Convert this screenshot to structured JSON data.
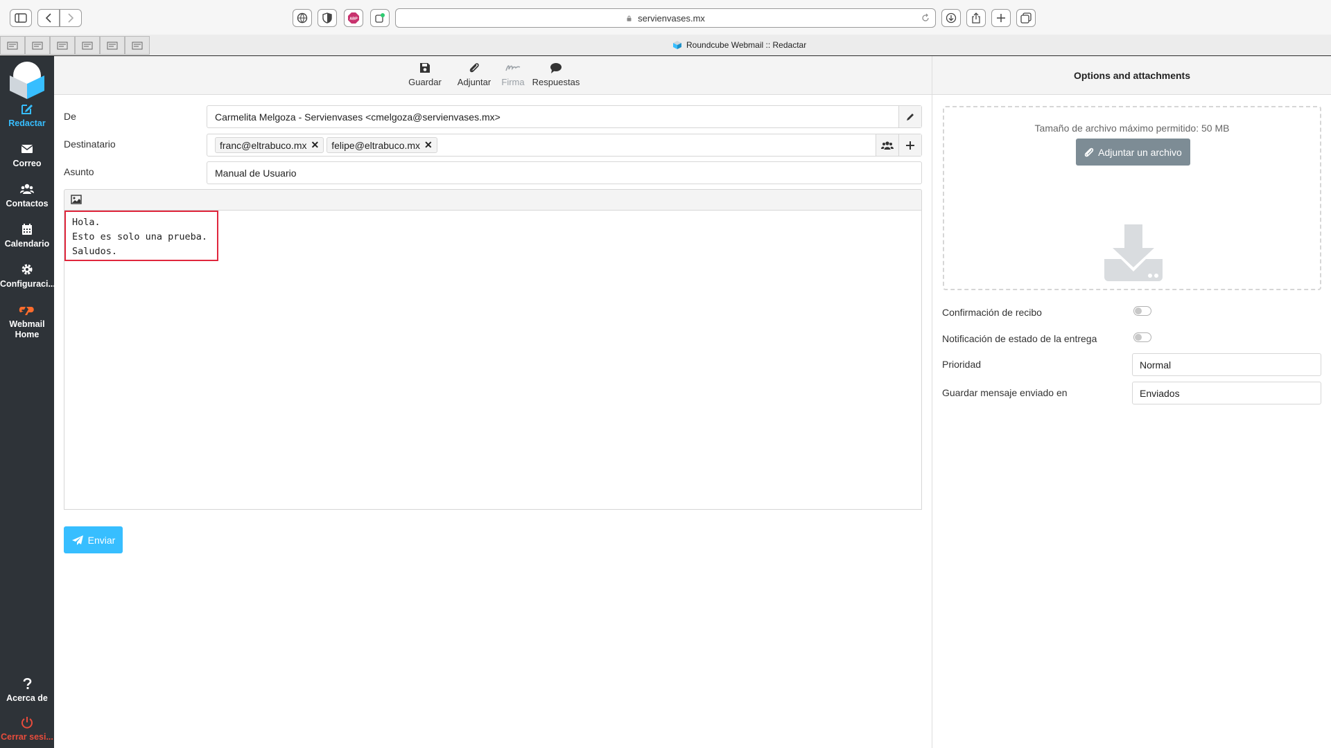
{
  "browser": {
    "url": "servienvases.mx",
    "tab_title": "Roundcube Webmail :: Redactar"
  },
  "sidebar": {
    "items": [
      {
        "label": "Redactar",
        "icon": "compose-icon"
      },
      {
        "label": "Correo",
        "icon": "mail-icon"
      },
      {
        "label": "Contactos",
        "icon": "contacts-icon"
      },
      {
        "label": "Calendario",
        "icon": "calendar-icon"
      },
      {
        "label": "Configuraci...",
        "icon": "gear-icon"
      },
      {
        "label_line1": "Webmail",
        "label_line2": "Home",
        "icon": "cpanel-icon"
      }
    ],
    "about": "Acerca de",
    "logout": "Cerrar sesi..."
  },
  "toolbar": {
    "save": "Guardar",
    "attach": "Adjuntar",
    "signature": "Firma",
    "responses": "Respuestas"
  },
  "compose": {
    "from_label": "De",
    "from_value": "Carmelita Melgoza - Servienvases <cmelgoza@servienvases.mx>",
    "to_label": "Destinatario",
    "recipients": [
      "franc@eltrabuco.mx",
      "felipe@eltrabuco.mx"
    ],
    "subject_label": "Asunto",
    "subject_value": "Manual de Usuario",
    "body": "Hola.\nEsto es solo una prueba.\nSaludos.",
    "send": "Enviar"
  },
  "panel": {
    "title": "Options and attachments",
    "max_size": "Tamaño de archivo máximo permitido: 50 MB",
    "attach_button": "Adjuntar un archivo",
    "read_receipt_label": "Confirmación de recibo",
    "read_receipt_on": false,
    "dsn_label": "Notificación de estado de la entrega",
    "dsn_on": false,
    "priority_label": "Prioridad",
    "priority_value": "Normal",
    "save_sent_label": "Guardar mensaje enviado en",
    "save_sent_value": "Enviados"
  },
  "colors": {
    "accent": "#37beff",
    "sidebar_bg": "#2e3338",
    "highlight_border": "#e0263c",
    "logout": "#e74c3c"
  }
}
